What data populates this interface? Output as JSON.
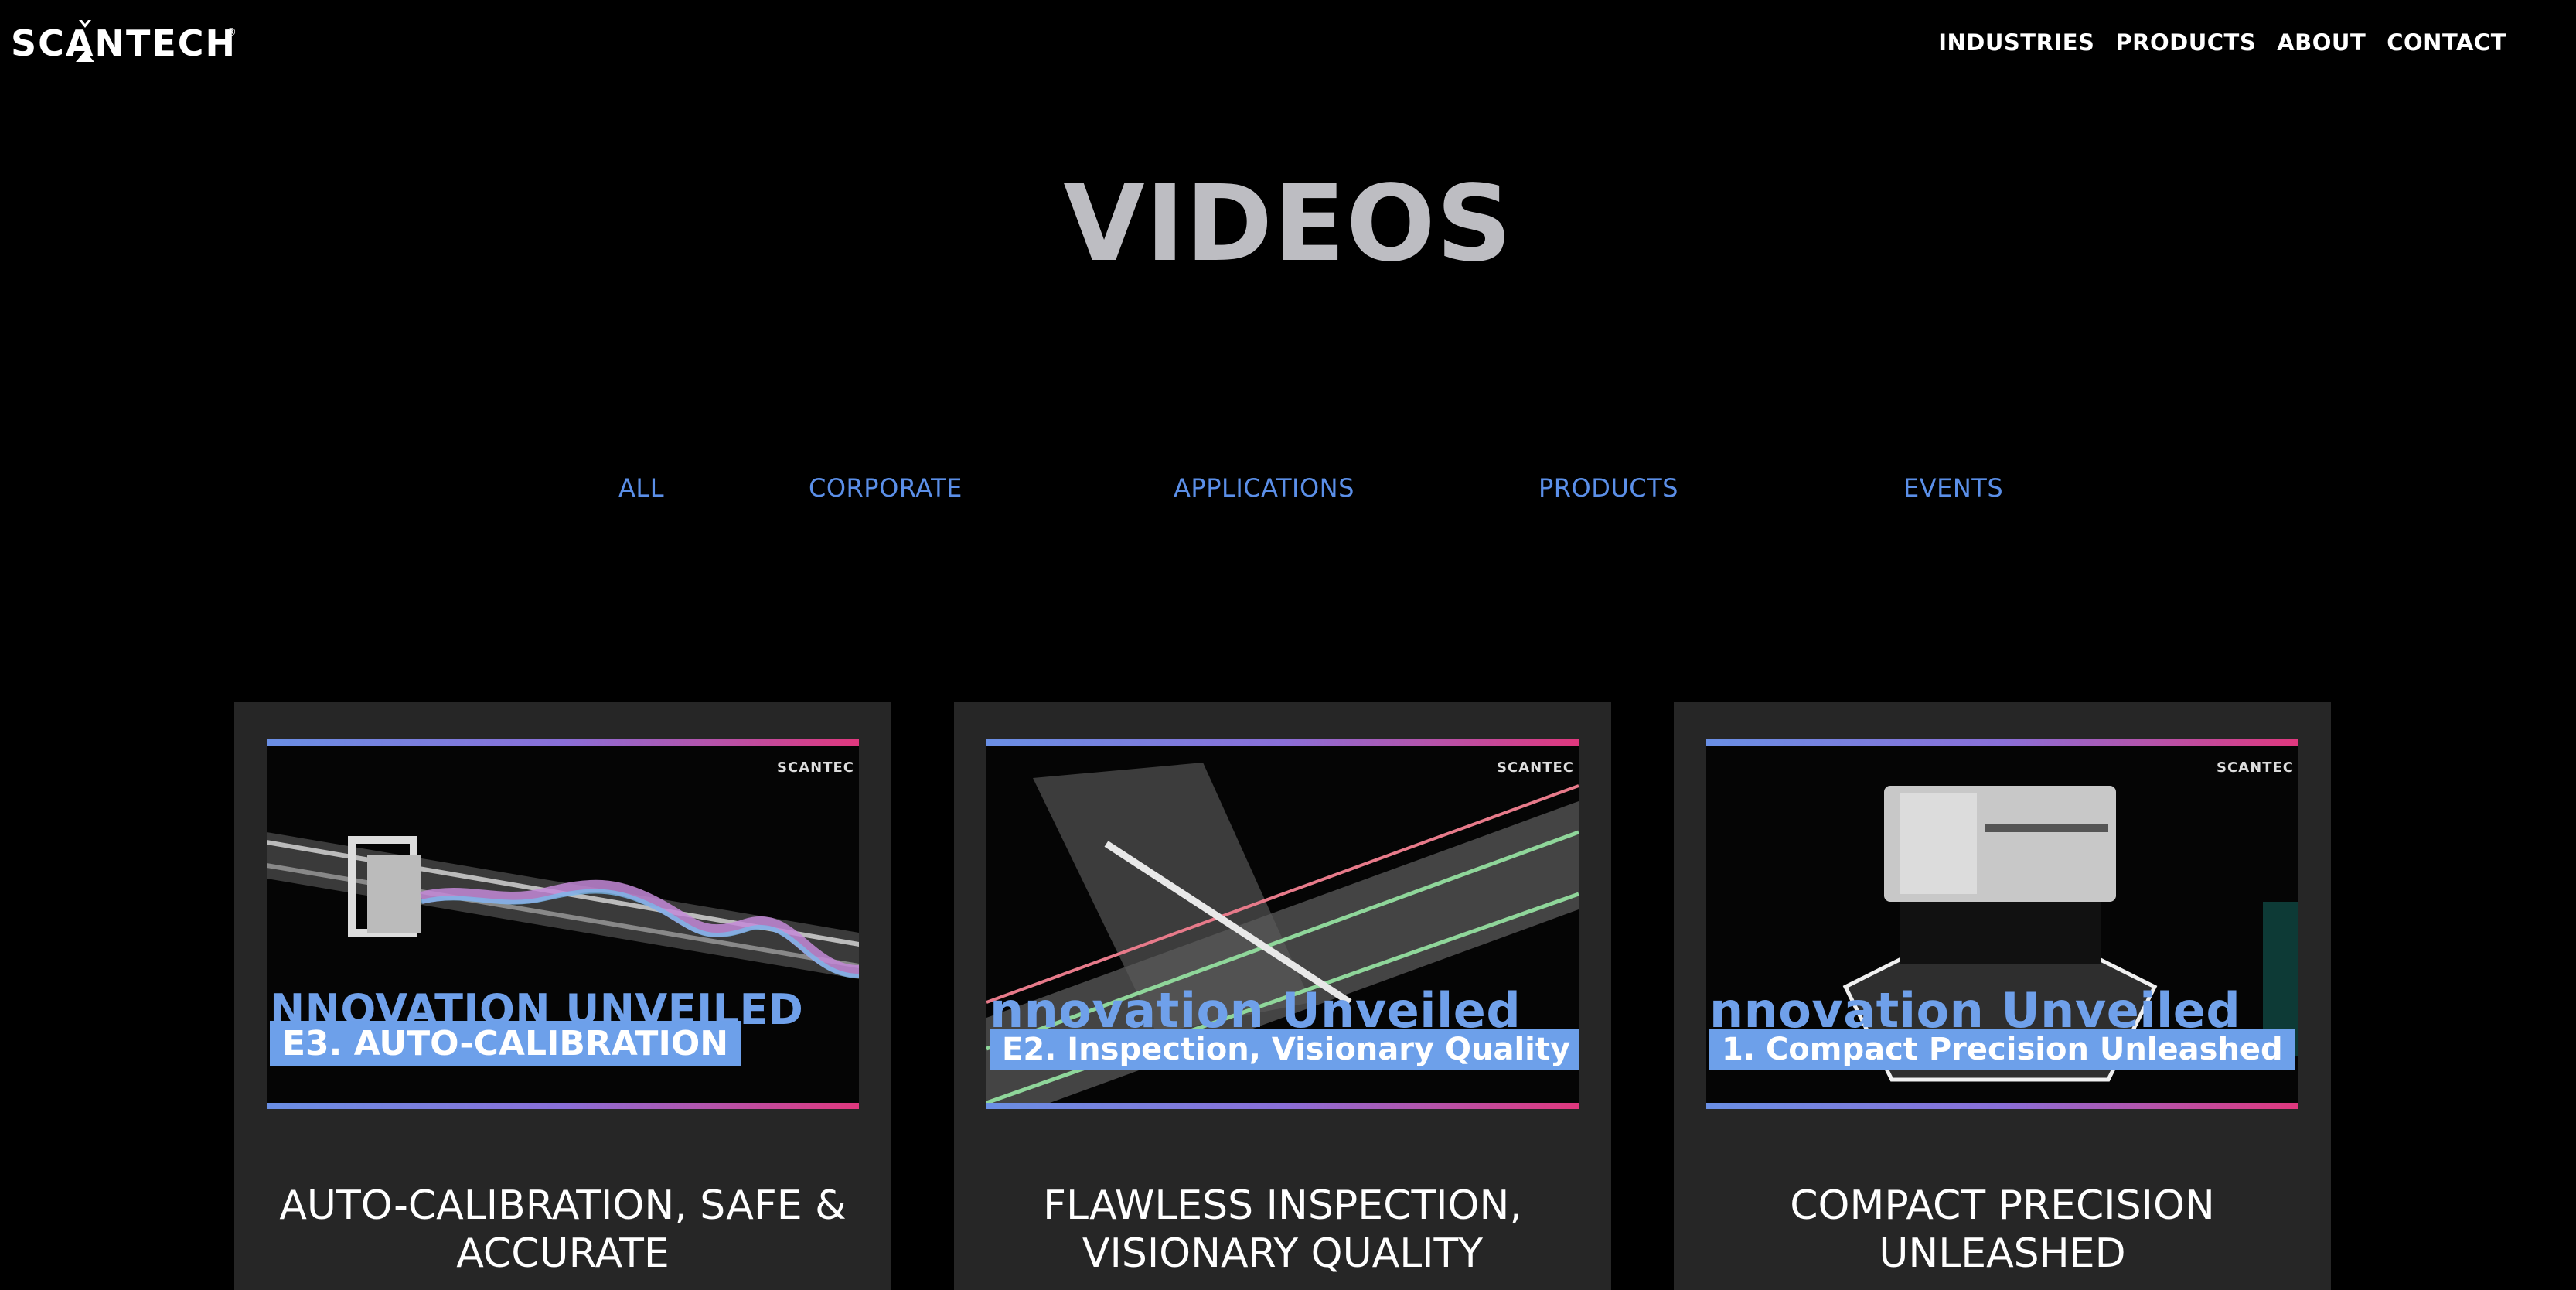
{
  "header": {
    "logo_text": "SCANTECH",
    "logo_mark": "®",
    "nav": [
      {
        "label": "INDUSTRIES"
      },
      {
        "label": "PRODUCTS"
      },
      {
        "label": "ABOUT"
      },
      {
        "label": "CONTACT"
      }
    ]
  },
  "page_title": "VIDEOS",
  "filters": [
    {
      "label": "ALL"
    },
    {
      "label": "CORPORATE"
    },
    {
      "label": "APPLICATIONS"
    },
    {
      "label": "PRODUCTS"
    },
    {
      "label": "EVENTS"
    }
  ],
  "videos": [
    {
      "thumb_brand": "SCANTEC",
      "thumb_headline": "NNOVATION UNVEILED",
      "thumb_banner": "E3. AUTO-CALIBRATION",
      "title_line1": "AUTO-CALIBRATION, SAFE &",
      "title_line2": "ACCURATE"
    },
    {
      "thumb_brand": "SCANTEC",
      "thumb_headline": "nnovation Unveiled",
      "thumb_banner": "E2. Inspection, Visionary Quality",
      "title_line1": "FLAWLESS INSPECTION,",
      "title_line2": "VISIONARY QUALITY"
    },
    {
      "thumb_brand": "SCANTEC",
      "thumb_headline": "nnovation Unveiled",
      "thumb_banner": "1. Compact Precision Unleashed",
      "title_line1": "COMPACT PRECISION",
      "title_line2": "UNLEASHED"
    }
  ],
  "colors": {
    "background": "#000000",
    "card": "#262626",
    "filter_text": "#5b8fe8",
    "title_text": "#bdbdc2",
    "gradient_start": "#6a8fe4",
    "gradient_end": "#e0387e"
  }
}
